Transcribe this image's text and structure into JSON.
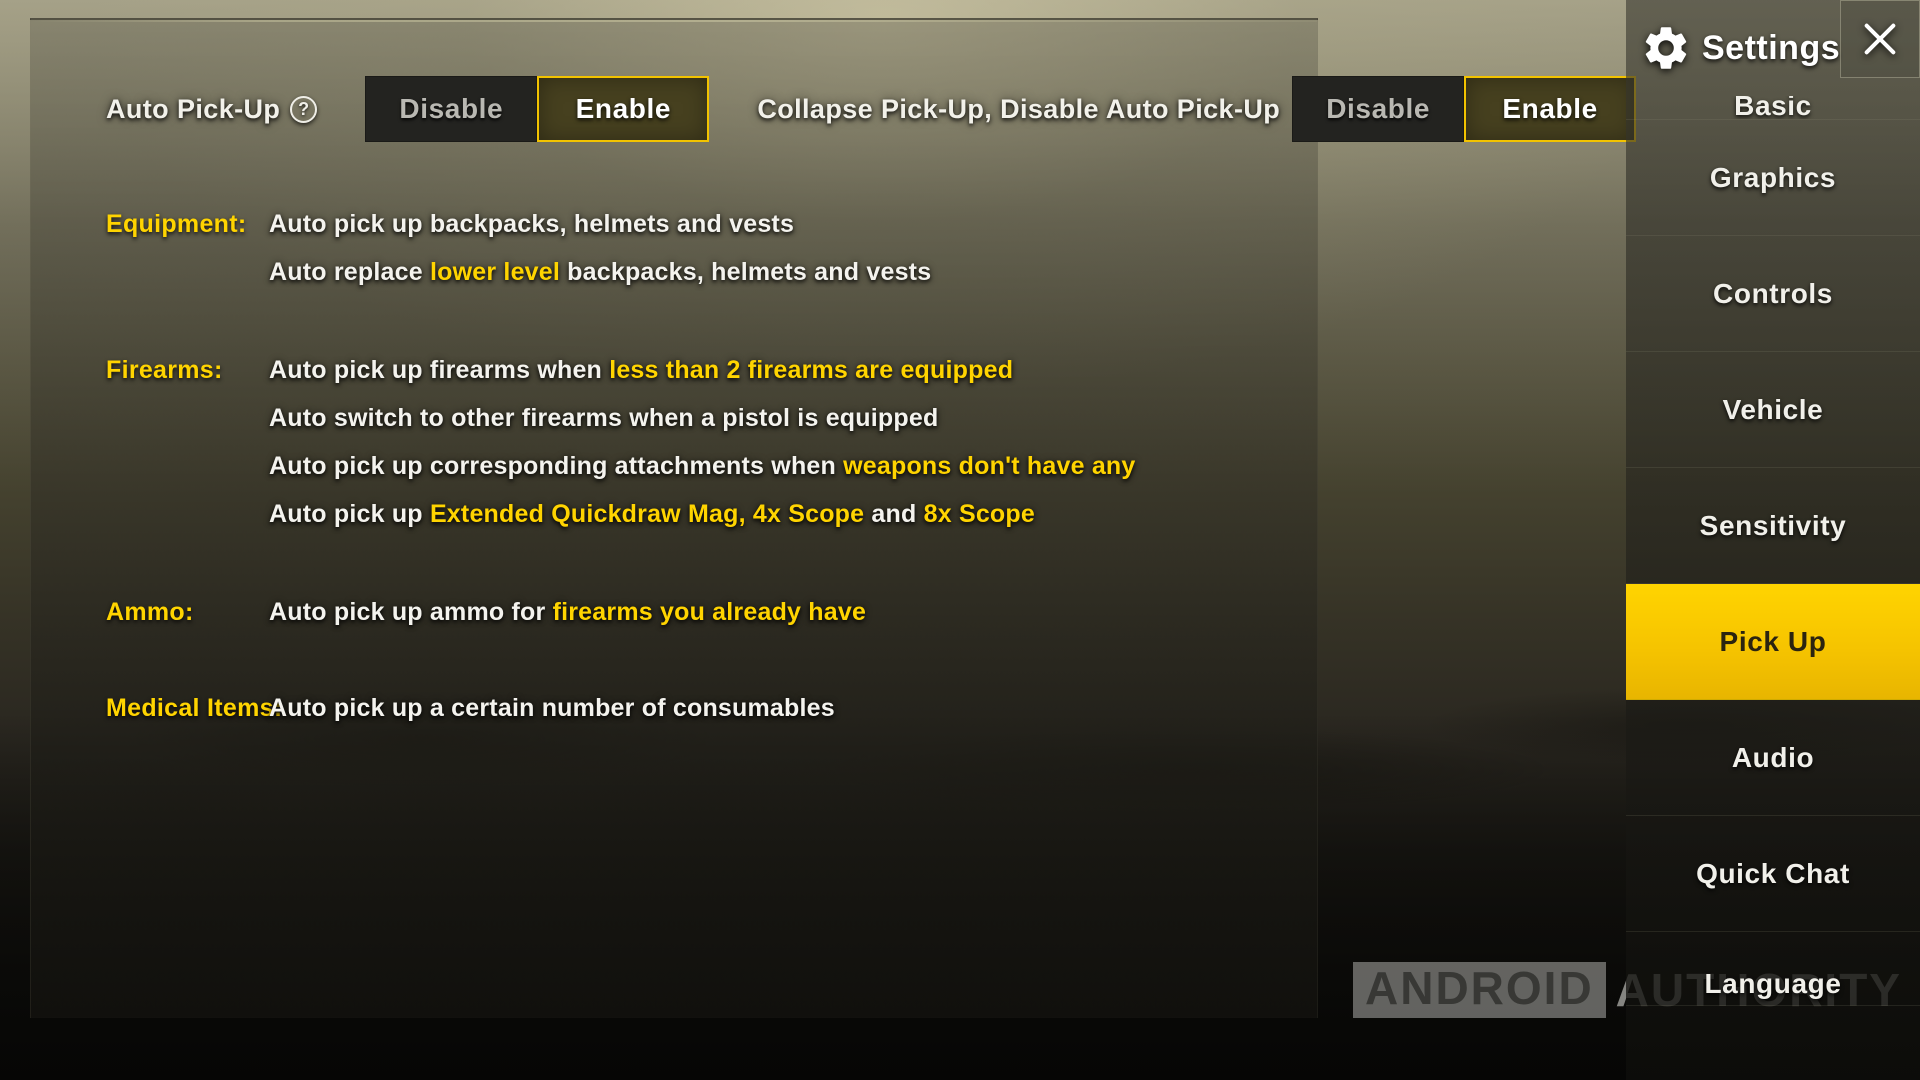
{
  "header": {
    "title": "Settings",
    "gear_icon": "gear-icon",
    "close_icon": "close-icon",
    "accent_color": "#ffd400"
  },
  "toggle_rows": [
    {
      "label": "Auto Pick-Up",
      "help_icon": "question-mark-icon",
      "has_help": true,
      "options": [
        "Disable",
        "Enable"
      ],
      "selected": "Enable"
    },
    {
      "label": "Collapse Pick-Up, Disable Auto Pick-Up",
      "has_help": false,
      "options": [
        "Disable",
        "Enable"
      ],
      "selected": "Enable"
    }
  ],
  "descriptions": [
    {
      "category": "Equipment:",
      "lines": [
        [
          {
            "t": "Auto pick up backpacks, helmets and vests",
            "hl": false
          }
        ],
        [
          {
            "t": "Auto replace ",
            "hl": false
          },
          {
            "t": "lower level",
            "hl": true
          },
          {
            "t": " backpacks, helmets and vests",
            "hl": false
          }
        ]
      ]
    },
    {
      "category": "Firearms:",
      "lines": [
        [
          {
            "t": "Auto pick up firearms when ",
            "hl": false
          },
          {
            "t": "less than 2 firearms are equipped",
            "hl": true
          }
        ],
        [
          {
            "t": "Auto switch to other firearms when a pistol is equipped",
            "hl": false
          }
        ],
        [
          {
            "t": "Auto pick up corresponding attachments when ",
            "hl": false
          },
          {
            "t": "weapons don't have any",
            "hl": true
          }
        ],
        [
          {
            "t": "Auto pick up ",
            "hl": false
          },
          {
            "t": "Extended Quickdraw Mag, 4x Scope",
            "hl": true
          },
          {
            "t": " and ",
            "hl": false
          },
          {
            "t": "8x Scope",
            "hl": true
          }
        ]
      ]
    },
    {
      "category": "Ammo:",
      "lines": [
        [
          {
            "t": "Auto pick up ammo for ",
            "hl": false
          },
          {
            "t": "firearms you already have",
            "hl": true
          }
        ]
      ]
    },
    {
      "category": "Medical Items:",
      "lines": [
        [
          {
            "t": "Auto pick up a certain number of consumables",
            "hl": false
          }
        ]
      ]
    }
  ],
  "sidebar": {
    "items": [
      {
        "label": "Basic",
        "active": false,
        "clip": "top"
      },
      {
        "label": "Graphics",
        "active": false,
        "clip": "none"
      },
      {
        "label": "Controls",
        "active": false,
        "clip": "none"
      },
      {
        "label": "Vehicle",
        "active": false,
        "clip": "none"
      },
      {
        "label": "Sensitivity",
        "active": false,
        "clip": "none"
      },
      {
        "label": "Pick Up",
        "active": true,
        "clip": "none"
      },
      {
        "label": "Audio",
        "active": false,
        "clip": "none"
      },
      {
        "label": "Quick Chat",
        "active": false,
        "clip": "none"
      },
      {
        "label": "Language",
        "active": false,
        "clip": "bottom"
      }
    ]
  },
  "watermark": {
    "part1": "ANDROID",
    "part2": "AUTHORITY"
  }
}
